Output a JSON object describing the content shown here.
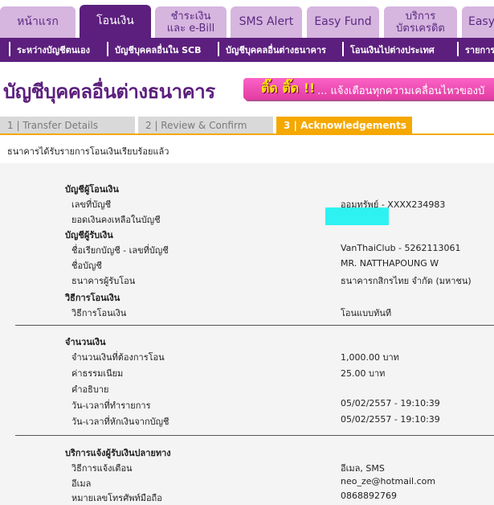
{
  "top_tabs": [
    {
      "label": "หน้าแรก",
      "line2": ""
    },
    {
      "label": "โอนเงิน",
      "line2": ""
    },
    {
      "label": "ชำระเงิน",
      "line2": "และ e-Bill"
    },
    {
      "label": "SMS Alert",
      "line2": ""
    },
    {
      "label": "Easy Fund",
      "line2": ""
    },
    {
      "label": "บริการ",
      "line2": "บัตรเครดิต"
    },
    {
      "label": "Easy",
      "line2": ""
    }
  ],
  "sub_nav": [
    "ระหว่างบัญชีตนเอง",
    "บัญชีบุคคลอื่นใน SCB",
    "บัญชีบุคคลอื่นต่างธนาคาร",
    "โอนเงินไปต่างประเทศ",
    "รายการ"
  ],
  "page_title": "บัญชีบุคคลอื่นต่างธนาคาร",
  "banner": {
    "hot": "ติ๊ด ติ๊ด !!",
    "text": "... แจ้งเตือนทุกความเคลื่อนไหวของบั"
  },
  "steps": [
    "1 | Transfer Details",
    "2 | Review & Confirm",
    "3 | Acknowledgements"
  ],
  "ack_message": "ธนาคารได้รับรายการโอนเงินเรียบร้อยแล้ว",
  "from_account": {
    "heading": "บัญชีผู้โอนเงิน",
    "account_no_label": "เลขที่บัญชี",
    "account_no_value": "ออมทรัพย์ - XXXX234983",
    "balance_label": "ยอดเงินคงเหลือในบัญชี"
  },
  "to_account": {
    "heading": "บัญชีผู้รับเงิน",
    "nickname_label": "ชื่อเรียกบัญชี - เลขที่บัญชี",
    "nickname_value": "VanThaiClub - 5262113061",
    "name_label": "ชื่อบัญชี",
    "name_value": "MR. NATTHAPOUNG W",
    "bank_label": "ธนาคารผู้รับโอน",
    "bank_value": "ธนาคารกสิกรไทย จำกัด (มหาชน)"
  },
  "method": {
    "heading": "วิธีการโอนเงิน",
    "label": "วิธีการโอนเงิน",
    "value": "โอนแบบทันที"
  },
  "amount": {
    "heading": "จำนวนเงิน",
    "amount_label": "จำนวนเงินที่ต้องการโอน",
    "amount_value": "1,000.00  บาท",
    "fee_label": "ค่าธรรมเนียม",
    "fee_value": "25.00  บาท",
    "desc_label": "คำอธิบาย",
    "txn_time_label": "วัน-เวลาที่ทำรายการ",
    "txn_time_value": "05/02/2557 - 19:10:39",
    "debit_time_label": "วัน-เวลาที่หักเงินจากบัญชี",
    "debit_time_value": "05/02/2557 - 19:10:39"
  },
  "notify": {
    "heading": "บริการแจ้งผู้รับเงินปลายทาง",
    "method_label": "วิธีการแจ้งเตือน",
    "method_value": "อีเมล, SMS",
    "email_label": "อีเมล",
    "email_value": "neo_ze@hotmail.com",
    "phone_label": "หมายเลขโทรศัพท์มือถือ",
    "phone_value": "0868892769"
  },
  "colors": {
    "brand": "#5c1f7d",
    "tab_inactive": "#d6b5df",
    "step_active": "#f5a800",
    "mask": "#2ef2f2",
    "banner": "#f04db5"
  }
}
